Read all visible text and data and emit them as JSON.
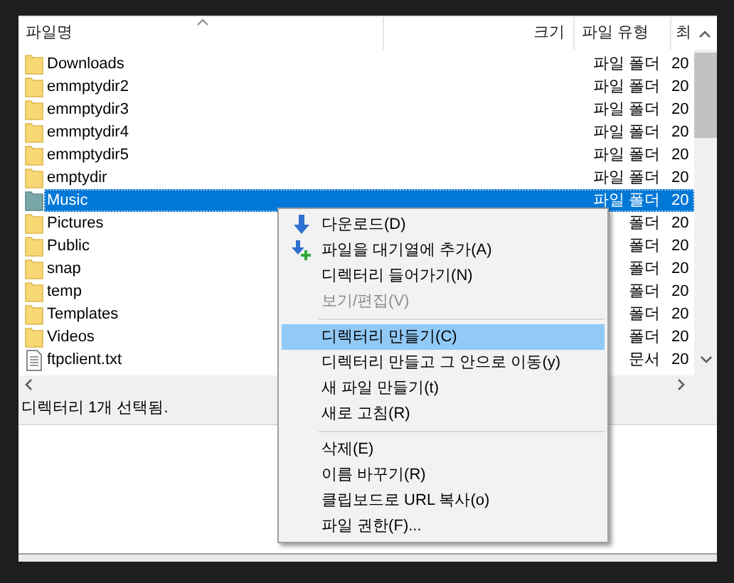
{
  "columns": [
    {
      "label": "파일명",
      "sort_ascending": true
    },
    {
      "label": "크기"
    },
    {
      "label": "파일 유형"
    },
    {
      "label": "최"
    }
  ],
  "rows": [
    {
      "name": "Downloads",
      "kind": "folder",
      "type": "파일 폴더",
      "date": "20",
      "selected": false
    },
    {
      "name": "emmptydir2",
      "kind": "folder",
      "type": "파일 폴더",
      "date": "20",
      "selected": false
    },
    {
      "name": "emmptydir3",
      "kind": "folder",
      "type": "파일 폴더",
      "date": "20",
      "selected": false
    },
    {
      "name": "emmptydir4",
      "kind": "folder",
      "type": "파일 폴더",
      "date": "20",
      "selected": false
    },
    {
      "name": "emmptydir5",
      "kind": "folder",
      "type": "파일 폴더",
      "date": "20",
      "selected": false
    },
    {
      "name": "emptydir",
      "kind": "folder",
      "type": "파일 폴더",
      "date": "20",
      "selected": false
    },
    {
      "name": "Music",
      "kind": "folder",
      "type": "파일 폴더",
      "date": "20",
      "selected": true
    },
    {
      "name": "Pictures",
      "kind": "folder",
      "type": "폴더",
      "date": "20",
      "selected": false
    },
    {
      "name": "Public",
      "kind": "folder",
      "type": "폴더",
      "date": "20",
      "selected": false
    },
    {
      "name": "snap",
      "kind": "folder",
      "type": "폴더",
      "date": "20",
      "selected": false
    },
    {
      "name": "temp",
      "kind": "folder",
      "type": "폴더",
      "date": "20",
      "selected": false
    },
    {
      "name": "Templates",
      "kind": "folder",
      "type": "폴더",
      "date": "20",
      "selected": false
    },
    {
      "name": "Videos",
      "kind": "folder",
      "type": "폴더",
      "date": "20",
      "selected": false
    },
    {
      "name": "ftpclient.txt",
      "kind": "file",
      "type": "문서",
      "date": "20",
      "selected": false
    }
  ],
  "status_bar": "디렉터리 1개 선택됨.",
  "context_menu": [
    {
      "kind": "download",
      "label": "다운로드(D)",
      "disabled": false,
      "selected": false
    },
    {
      "kind": "queue",
      "label": "파일을 대기열에 추가(A)",
      "disabled": false,
      "selected": false
    },
    {
      "kind": "item",
      "label": "디렉터리 들어가기(N)",
      "disabled": false,
      "selected": false
    },
    {
      "kind": "item",
      "label": "보기/편집(V)",
      "disabled": true,
      "selected": false
    },
    {
      "kind": "separator"
    },
    {
      "kind": "item",
      "label": "디렉터리 만들기(C)",
      "disabled": false,
      "selected": true
    },
    {
      "kind": "item",
      "label": "디렉터리 만들고 그 안으로 이동(y)",
      "disabled": false,
      "selected": false
    },
    {
      "kind": "item",
      "label": "새 파일 만들기(t)",
      "disabled": false,
      "selected": false
    },
    {
      "kind": "item",
      "label": "새로 고침(R)",
      "disabled": false,
      "selected": false
    },
    {
      "kind": "separator"
    },
    {
      "kind": "item",
      "label": "삭제(E)",
      "disabled": false,
      "selected": false
    },
    {
      "kind": "item",
      "label": "이름 바꾸기(R)",
      "disabled": false,
      "selected": false
    },
    {
      "kind": "item",
      "label": "클립보드로 URL 복사(o)",
      "disabled": false,
      "selected": false
    },
    {
      "kind": "item",
      "label": "파일 권한(F)...",
      "disabled": false,
      "selected": false
    }
  ]
}
